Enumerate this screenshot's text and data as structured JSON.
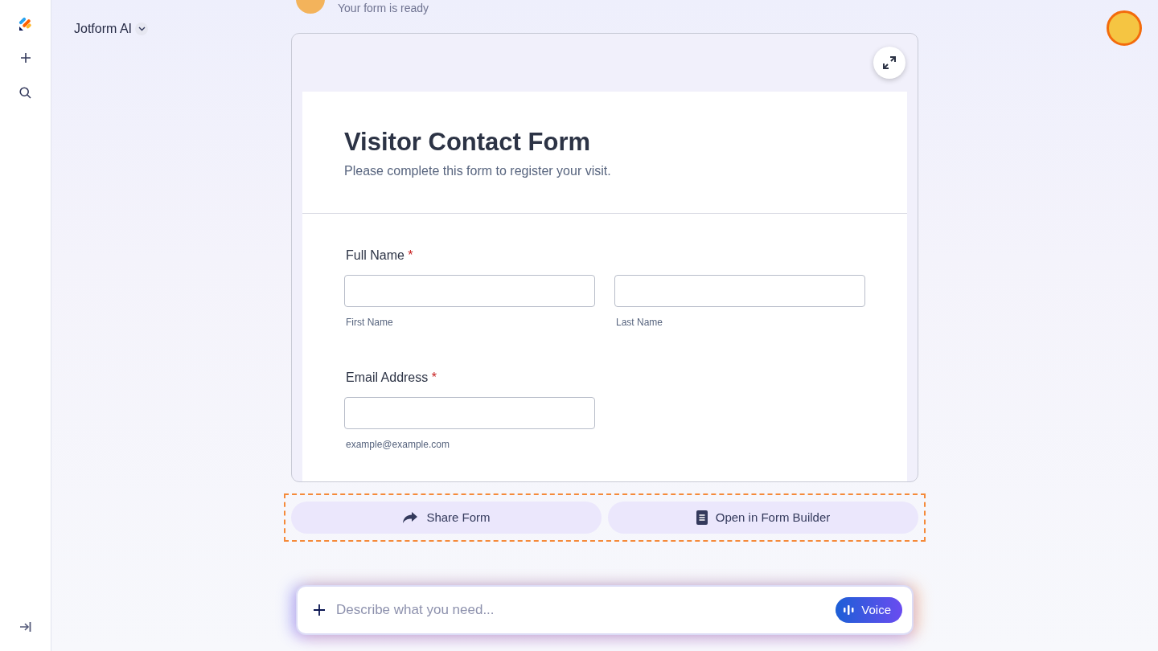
{
  "app_menu": {
    "label": "Jotform AI"
  },
  "chat_message": {
    "text": "Your form is ready"
  },
  "form_preview": {
    "title": "Visitor Contact Form",
    "subtitle": "Please complete this form to register your visit.",
    "fields": [
      {
        "label": "Full Name",
        "required_mark": "*",
        "inputs": [
          {
            "sublabel": "First Name"
          },
          {
            "sublabel": "Last Name"
          }
        ]
      },
      {
        "label": "Email Address",
        "required_mark": "*",
        "inputs": [
          {
            "sublabel": "example@example.com"
          }
        ]
      }
    ]
  },
  "actions": [
    {
      "kind": "share",
      "label": "Share Form"
    },
    {
      "kind": "builder",
      "label": "Open in Form Builder"
    }
  ],
  "composer": {
    "placeholder": "Describe what you need...",
    "voice_button": "Voice"
  }
}
